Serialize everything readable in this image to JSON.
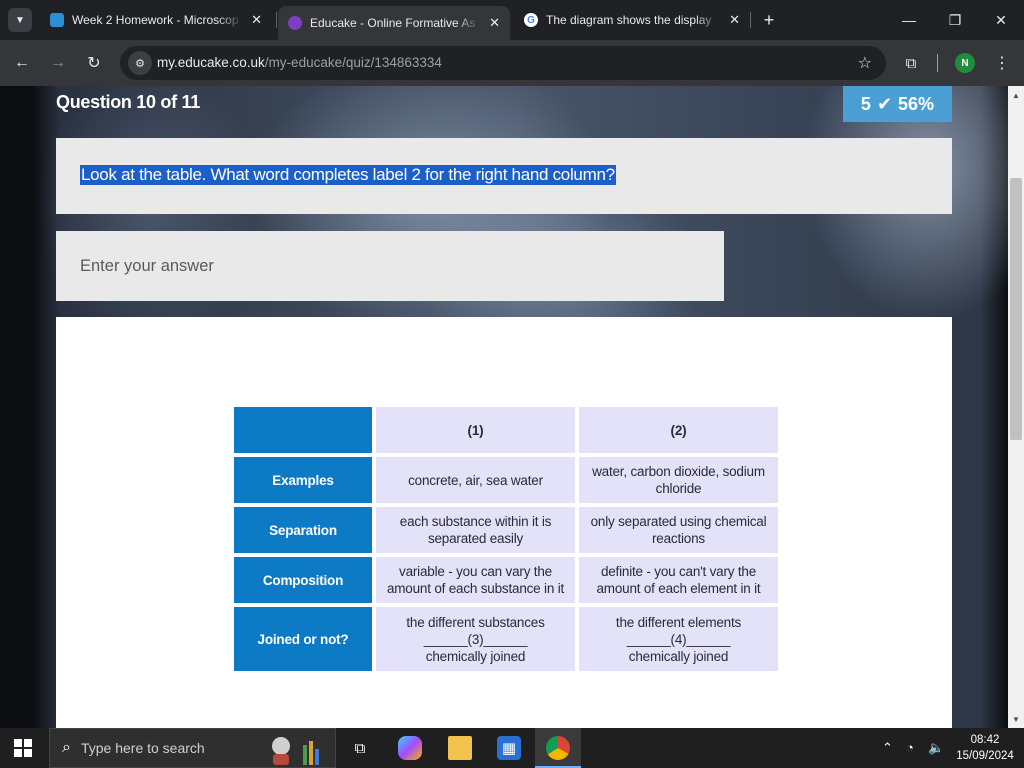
{
  "browser": {
    "tabs": [
      {
        "title": "Week 2 Homework - Microscop",
        "favicon_color": "#2b8fd8"
      },
      {
        "title": "Educake - Online Formative As",
        "favicon_color": "#7b3fc4"
      },
      {
        "title": "The diagram shows the display",
        "favicon_color": "#4285f4"
      }
    ],
    "new_tab_label": "+",
    "url_host": "my.educake.co.uk",
    "url_path": "/my-educake/quiz/134863334",
    "profile_initial": "N"
  },
  "quiz": {
    "question_heading": "Question 10 of 11",
    "score_count": "5",
    "score_percent": "56%",
    "question_text": "Look at the table. What word completes label 2 for the right hand column?",
    "answer_placeholder": "Enter your answer",
    "answer_value": ""
  },
  "diagram_table": {
    "headers": [
      "",
      "(1)",
      "(2)"
    ],
    "rows": [
      {
        "label": "Examples",
        "col1": [
          "concrete, air, sea water"
        ],
        "col2": [
          "water, carbon dioxide, sodium",
          "chloride"
        ]
      },
      {
        "label": "Separation",
        "col1": [
          "each substance within it is",
          "separated easily"
        ],
        "col2": [
          "only separated using chemical",
          "reactions"
        ]
      },
      {
        "label": "Composition",
        "col1": [
          "variable - you can vary the",
          "amount of each substance in it"
        ],
        "col2": [
          "definite - you can't vary the",
          "amount of each element in it"
        ]
      },
      {
        "label": "Joined or not?",
        "col1": [
          "the different substances",
          "______(3)______",
          "chemically joined"
        ],
        "col2": [
          "the different elements",
          "______(4)______",
          "chemically joined"
        ]
      }
    ]
  },
  "taskbar": {
    "search_placeholder": "Type here to search",
    "time": "08:42",
    "date": "15/09/2024"
  },
  "colors": {
    "accent_blue": "#0d7ac5",
    "cell_lavender": "#e4e2f8",
    "score_blue": "#4c9fd3",
    "selection_blue": "#1c5fc9"
  }
}
